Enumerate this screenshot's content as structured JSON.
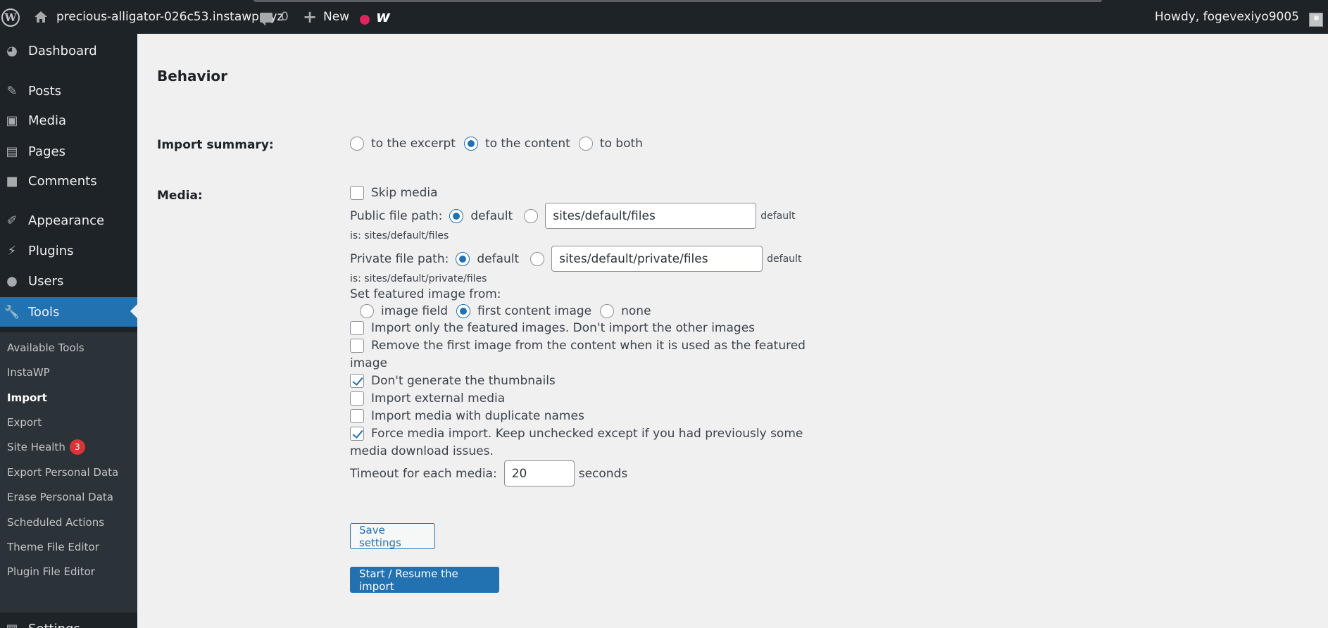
{
  "adminbar": {
    "site_name": "precious-alligator-026c53.instawp.xyz",
    "comment_count": "0",
    "new_label": "New",
    "howdy": "Howdy, fogevexiyo9005",
    "logo_glyph": "W",
    "plus_glyph": "+",
    "w_glyph": "w"
  },
  "sidebar": {
    "items": [
      {
        "label": "Dashboard",
        "icon": "dashboard-icon"
      },
      {
        "label": "Posts",
        "icon": "pin-icon"
      },
      {
        "label": "Media",
        "icon": "media-icon"
      },
      {
        "label": "Pages",
        "icon": "pages-icon"
      },
      {
        "label": "Comments",
        "icon": "comments-icon"
      },
      {
        "label": "Appearance",
        "icon": "brush-icon"
      },
      {
        "label": "Plugins",
        "icon": "plug-icon"
      },
      {
        "label": "Users",
        "icon": "user-icon"
      },
      {
        "label": "Tools",
        "icon": "wrench-icon"
      },
      {
        "label": "Settings",
        "icon": "settings-icon"
      }
    ],
    "submenu": [
      {
        "label": "Available Tools"
      },
      {
        "label": "InstaWP"
      },
      {
        "label": "Import"
      },
      {
        "label": "Export"
      },
      {
        "label": "Site Health",
        "badge": "3"
      },
      {
        "label": "Export Personal Data"
      },
      {
        "label": "Erase Personal Data"
      },
      {
        "label": "Scheduled Actions"
      },
      {
        "label": "Theme File Editor"
      },
      {
        "label": "Plugin File Editor"
      }
    ]
  },
  "main": {
    "heading": "Behavior",
    "import_summary": {
      "label": "Import summary:",
      "options": [
        "to the excerpt",
        "to the content",
        "to both"
      ],
      "selected": "to the content"
    },
    "media": {
      "label": "Media:",
      "skip_media": "Skip media",
      "public_path_label": "Public file path:",
      "public_default_label": "default",
      "public_path_value": "sites/default/files",
      "public_hint": "default",
      "public_hint2": "is: sites/default/files",
      "private_path_label": "Private file path:",
      "private_default_label": "default",
      "private_path_value": "sites/default/private/files",
      "private_hint": "default",
      "private_hint2": "is: sites/default/private/files",
      "featured_label": "Set featured image from:",
      "featured_options": [
        "image field",
        "first content image",
        "none"
      ],
      "featured_selected": "first content image",
      "only_featured": "Import only the featured images. Don't import the other images",
      "remove_first_1": "Remove the first image from the content when it is used as the featured",
      "remove_first_2": "image",
      "no_thumbnails": "Don't generate the thumbnails",
      "external_media": "Import external media",
      "duplicate_names": "Import media with duplicate names",
      "force_import_1": "Force media import. Keep unchecked except if you had previously some",
      "force_import_2": "media download issues.",
      "timeout_label": "Timeout for each media:",
      "timeout_value": "20",
      "timeout_unit": "seconds"
    },
    "save_button": "Save settings",
    "start_button": "Start / Resume the import"
  },
  "colors": {
    "admin_dark": "#1d2327",
    "accent": "#2271b1",
    "badge": "#d63638"
  }
}
